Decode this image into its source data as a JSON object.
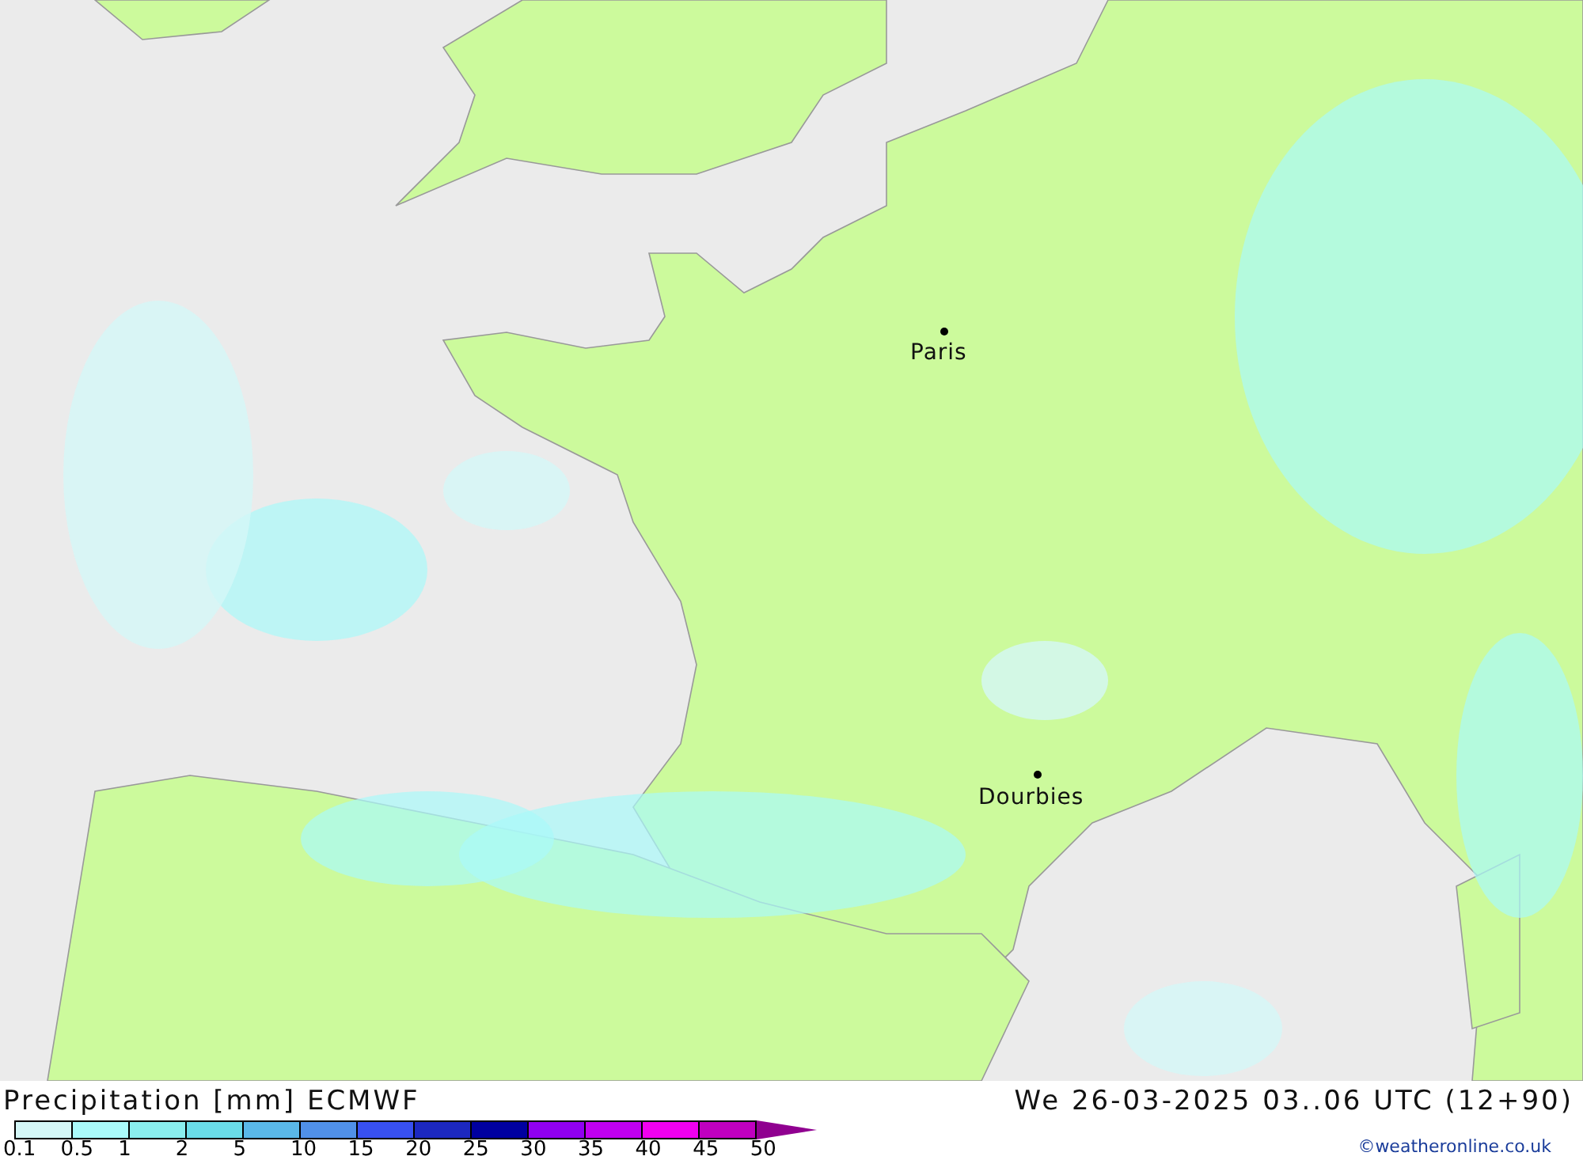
{
  "map": {
    "cities": [
      {
        "name": "Paris"
      },
      {
        "name": "Dourbies"
      }
    ]
  },
  "footer": {
    "title": "Precipitation [mm] ECMWF",
    "date": "We 26-03-2025 03..06 UTC (12+90)",
    "credit": "©weatheronline.co.uk",
    "legend": [
      {
        "label": "0.1",
        "color": "#d4f7f7"
      },
      {
        "label": "0.5",
        "color": "#aafafa"
      },
      {
        "label": "1",
        "color": "#8aeeee"
      },
      {
        "label": "2",
        "color": "#6adce8"
      },
      {
        "label": "5",
        "color": "#5ab8e8"
      },
      {
        "label": "10",
        "color": "#5090e8"
      },
      {
        "label": "15",
        "color": "#3850f0"
      },
      {
        "label": "20",
        "color": "#1c28c0"
      },
      {
        "label": "25",
        "color": "#0000a0"
      },
      {
        "label": "30",
        "color": "#9000f0"
      },
      {
        "label": "35",
        "color": "#c000f0"
      },
      {
        "label": "40",
        "color": "#f000f0"
      },
      {
        "label": "45",
        "color": "#c000c0"
      }
    ],
    "legend_end": {
      "label": "50",
      "color": "#900090"
    }
  }
}
